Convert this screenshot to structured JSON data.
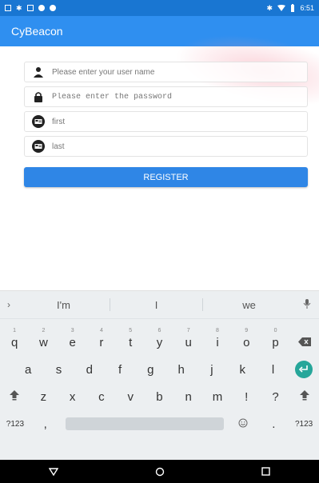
{
  "status_bar": {
    "time": "6:51"
  },
  "app": {
    "title": "CyBeacon"
  },
  "form": {
    "username_placeholder": "Please enter your user name",
    "password_placeholder": "Please enter the password",
    "first_placeholder": "first",
    "last_placeholder": "last",
    "register_label": "REGISTER"
  },
  "keyboard": {
    "suggestions": [
      "I'm",
      "I",
      "we"
    ],
    "row1": [
      {
        "key": "q",
        "hint": "1"
      },
      {
        "key": "w",
        "hint": "2"
      },
      {
        "key": "e",
        "hint": "3"
      },
      {
        "key": "r",
        "hint": "4"
      },
      {
        "key": "t",
        "hint": "5"
      },
      {
        "key": "y",
        "hint": "6"
      },
      {
        "key": "u",
        "hint": "7"
      },
      {
        "key": "i",
        "hint": "8"
      },
      {
        "key": "o",
        "hint": "9"
      },
      {
        "key": "p",
        "hint": "0"
      }
    ],
    "row2": [
      "a",
      "s",
      "d",
      "f",
      "g",
      "h",
      "j",
      "k",
      "l"
    ],
    "row3": [
      "z",
      "x",
      "c",
      "v",
      "b",
      "n",
      "m",
      "!",
      "?"
    ],
    "row4": {
      "left_label": "?123",
      "comma": ",",
      "period": ".",
      "right_label": "?123"
    }
  },
  "colors": {
    "status_bar": "#1976d2",
    "app_bar": "#2f8ff0",
    "button": "#2f86e6",
    "enter_key": "#26a69a"
  }
}
